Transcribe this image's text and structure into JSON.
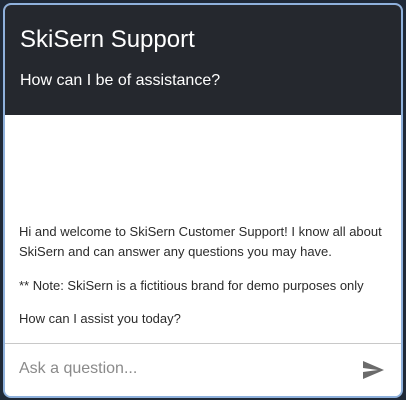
{
  "header": {
    "title": "SkiSern Support",
    "subtitle": "How can I be of assistance?"
  },
  "messages": [
    "Hi and welcome to SkiSern Customer Support! I know all about SkiSern and can answer any questions you may have.",
    "** Note: SkiSern is a fictitious brand for demo purposes only",
    "How can I assist you today?"
  ],
  "input": {
    "placeholder": "Ask a question...",
    "value": ""
  },
  "icons": {
    "send": "send-icon"
  },
  "colors": {
    "header_bg": "#25282e",
    "border": "#8fb1dc",
    "send_icon": "#6b6b6b"
  }
}
